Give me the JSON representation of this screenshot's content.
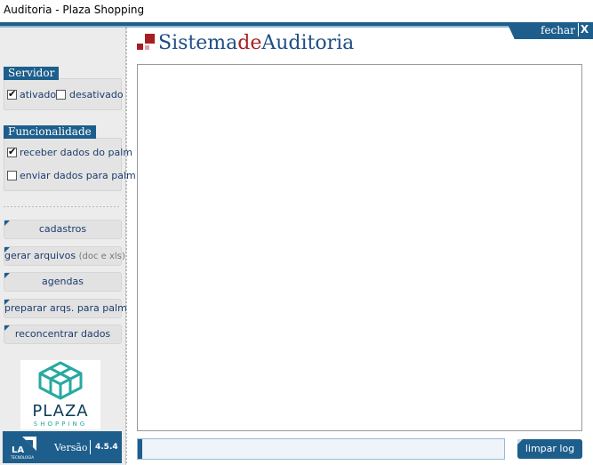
{
  "window": {
    "title": "Auditoria - Plaza Shopping"
  },
  "header": {
    "close_label": "fechar",
    "close_x": "X",
    "brand": {
      "part1": "Sistema",
      "part2": "de",
      "part3": "Auditoria"
    }
  },
  "sidebar": {
    "servidor": {
      "title": "Servidor",
      "options": [
        {
          "label": "ativado",
          "checked": true
        },
        {
          "label": "desativado",
          "checked": false
        }
      ]
    },
    "funcionalidade": {
      "title": "Funcionalidade",
      "options": [
        {
          "label": "receber dados do palm",
          "checked": true
        },
        {
          "label": "enviar dados para palm",
          "checked": false
        }
      ]
    },
    "nav": [
      {
        "label": "cadastros"
      },
      {
        "label": "gerar arquivos",
        "note": "(doc e xls)"
      },
      {
        "label": "agendas"
      },
      {
        "label": "preparar arqs. para palm"
      },
      {
        "label": "reconcentrar dados"
      }
    ],
    "logo": {
      "word": "PLAZA",
      "sub": "SHOPPING"
    },
    "version": {
      "la_text": "LA",
      "la_sub": "TECNOLOGIA",
      "label": "Versão",
      "number": "4.5.4"
    }
  },
  "main": {
    "log_text": "",
    "progress": 0,
    "clear_label": "limpar log"
  },
  "colors": {
    "accent": "#1d5e8c",
    "brand_blue": "#1d4e86",
    "brand_red": "#a71e22",
    "teal": "#27a9a0"
  }
}
